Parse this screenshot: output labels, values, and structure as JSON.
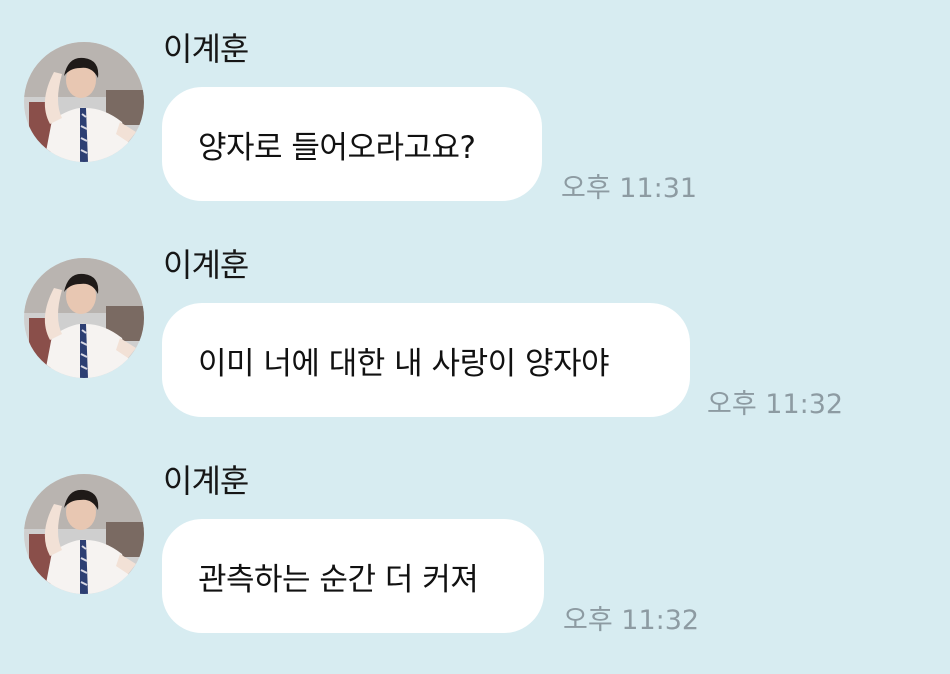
{
  "colors": {
    "background": "#d7ecf1",
    "bubble": "#ffffff",
    "timestamp": "#8d9ba2",
    "text": "#111111"
  },
  "messages": [
    {
      "sender": "이계훈",
      "avatar": "avatar-photo",
      "text": "양자로 들어오라고요?",
      "time": "오후 11:31"
    },
    {
      "sender": "이계훈",
      "avatar": "avatar-photo",
      "text": "이미 너에 대한 내 사랑이 양자야",
      "time": "오후 11:32"
    },
    {
      "sender": "이계훈",
      "avatar": "avatar-photo",
      "text": "관측하는 순간 더 커져",
      "time": "오후 11:32"
    }
  ]
}
